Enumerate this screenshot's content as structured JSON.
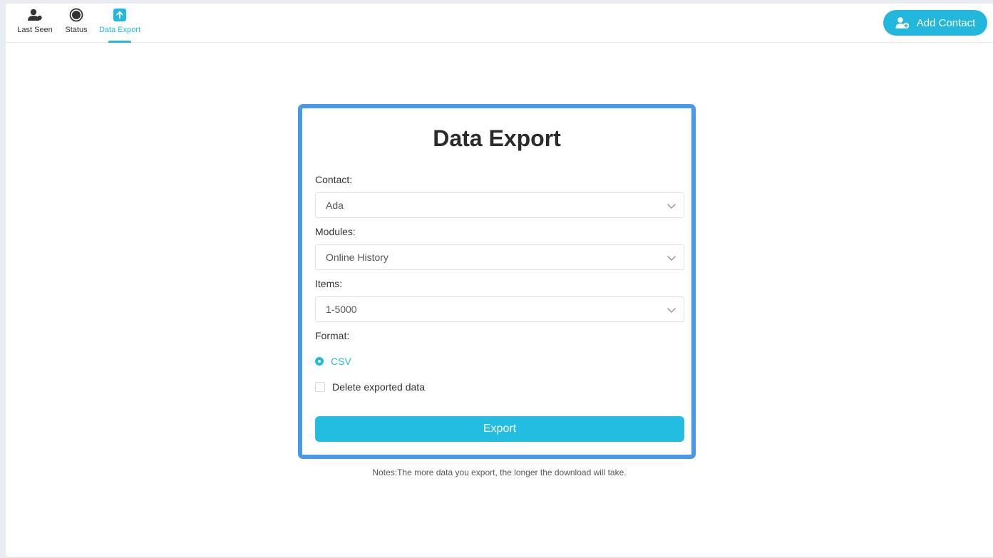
{
  "nav": {
    "tabs": [
      {
        "label": "Last Seen",
        "icon": "person-icon",
        "active": false
      },
      {
        "label": "Status",
        "icon": "status-circle-icon",
        "active": false
      },
      {
        "label": "Data Export",
        "icon": "upload-arrow-icon",
        "active": true
      }
    ],
    "add_contact_label": "Add Contact",
    "add_contact_icon": "add-user-icon"
  },
  "form": {
    "title": "Data Export",
    "contact_label": "Contact:",
    "contact_value": "Ada",
    "modules_label": "Modules:",
    "modules_value": "Online History",
    "items_label": "Items:",
    "items_value": "1-5000",
    "format_label": "Format:",
    "format_option": "CSV",
    "delete_label": "Delete exported data",
    "export_label": "Export"
  },
  "notes": "Notes:The more data you export, the longer the download will take.",
  "colors": {
    "accent": "#22b8dd",
    "card_border": "#4a98e8",
    "background": "#e9ecf1"
  }
}
